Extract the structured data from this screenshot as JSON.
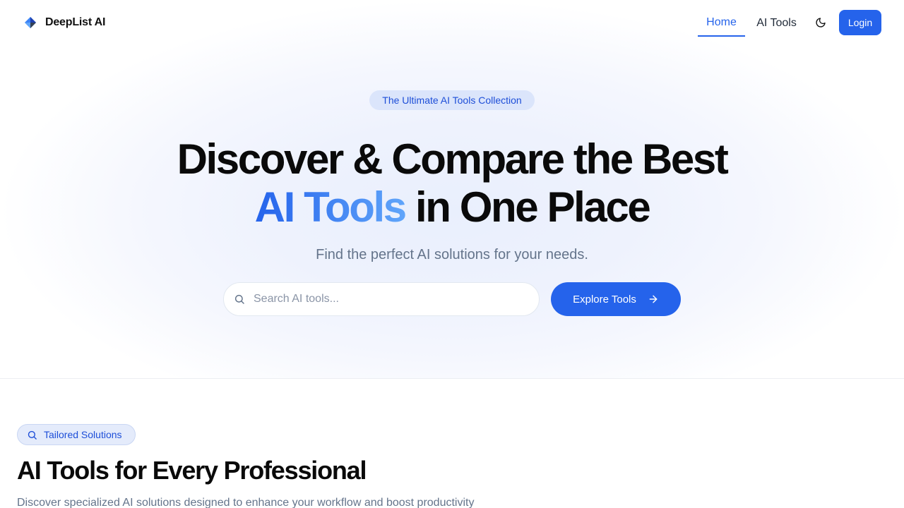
{
  "nav": {
    "brand": "DeepList AI",
    "links": [
      {
        "label": "Home",
        "active": true
      },
      {
        "label": "AI Tools",
        "active": false
      }
    ],
    "theme_icon": "moon-icon",
    "login_label": "Login"
  },
  "hero": {
    "badge": "The Ultimate AI Tools Collection",
    "headline": {
      "line1_highlight": "Discover",
      "line1_rest": " & Compare the Best",
      "line2_accent": "AI Tools",
      "line2_rest": " in One Place"
    },
    "subheadline": "Find the perfect AI solutions for your needs.",
    "search": {
      "placeholder": "Search AI tools...",
      "value": "",
      "icon": "search-icon"
    },
    "cta_label": "Explore Tools",
    "cta_icon": "arrow-right-icon"
  },
  "section": {
    "badge": "Tailored Solutions",
    "badge_icon": "search-icon",
    "title": "AI Tools for Every Professional",
    "description": "Discover specialized AI solutions designed to enhance your workflow and boost productivity"
  },
  "colors": {
    "primary": "#2563eb",
    "accent_gradient_end": "#60a5fa",
    "muted_text": "#64748b",
    "badge_bg": "#dbe5fb"
  }
}
